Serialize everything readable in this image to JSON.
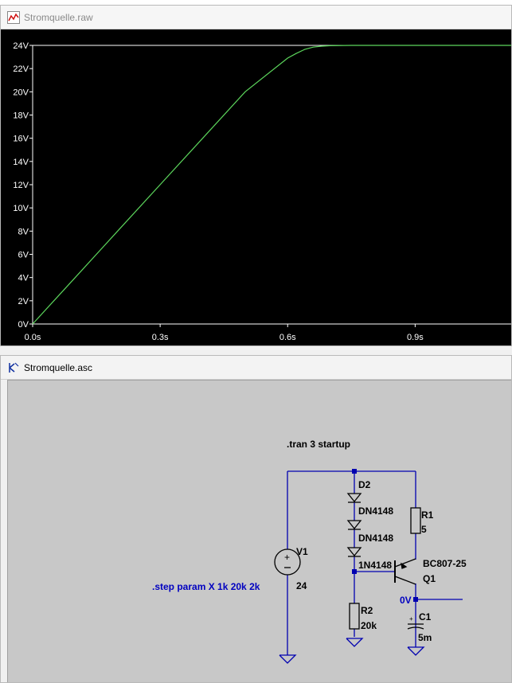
{
  "plot_window": {
    "title": "Stromquelle.raw",
    "icon": "waveform-icon"
  },
  "schematic_window": {
    "title": "Stromquelle.asc",
    "icon": "schematic-icon"
  },
  "chart_data": {
    "type": "line",
    "title": "",
    "xlabel": "",
    "ylabel": "",
    "x_ticks": [
      "0.0s",
      "0.3s",
      "0.6s",
      "0.9s"
    ],
    "y_ticks": [
      "0V",
      "2V",
      "4V",
      "6V",
      "8V",
      "10V",
      "12V",
      "14V",
      "16V",
      "18V",
      "20V",
      "22V",
      "24V"
    ],
    "xlim": [
      0,
      1.126
    ],
    "ylim": [
      0,
      24
    ],
    "grid": false,
    "series": [
      {
        "name": "",
        "color": "#5cd65c",
        "x": [
          0,
          0.05,
          0.1,
          0.2,
          0.3,
          0.4,
          0.5,
          0.6,
          0.62,
          0.64,
          0.66,
          0.68,
          0.7,
          0.75,
          0.8,
          0.9,
          1.0,
          1.126
        ],
        "y": [
          0,
          2.0,
          4.0,
          8.0,
          12.0,
          16.0,
          20.0,
          22.9,
          23.3,
          23.65,
          23.85,
          23.93,
          23.97,
          24.0,
          24.0,
          24.0,
          24.0,
          24.0
        ]
      }
    ]
  },
  "schematic": {
    "directive_tran": ".tran 3 startup",
    "directive_step": ".step param X 1k 20k 2k",
    "v1_name": "V1",
    "v1_value": "24",
    "d2_name": "D2",
    "d1_overlap": "DN4148",
    "d3_overlap": "DN4148",
    "d_model": "1N4148",
    "r1_name": "R1",
    "r1_value": "5",
    "r2_name": "R2",
    "r2_value": "20k",
    "q1_model": "BC807-25",
    "q1_name": "Q1",
    "c1_name": "C1",
    "c1_value": "5m",
    "node_label": "0V",
    "wire_color": "#0000b0",
    "step_color": "#0000c0"
  }
}
